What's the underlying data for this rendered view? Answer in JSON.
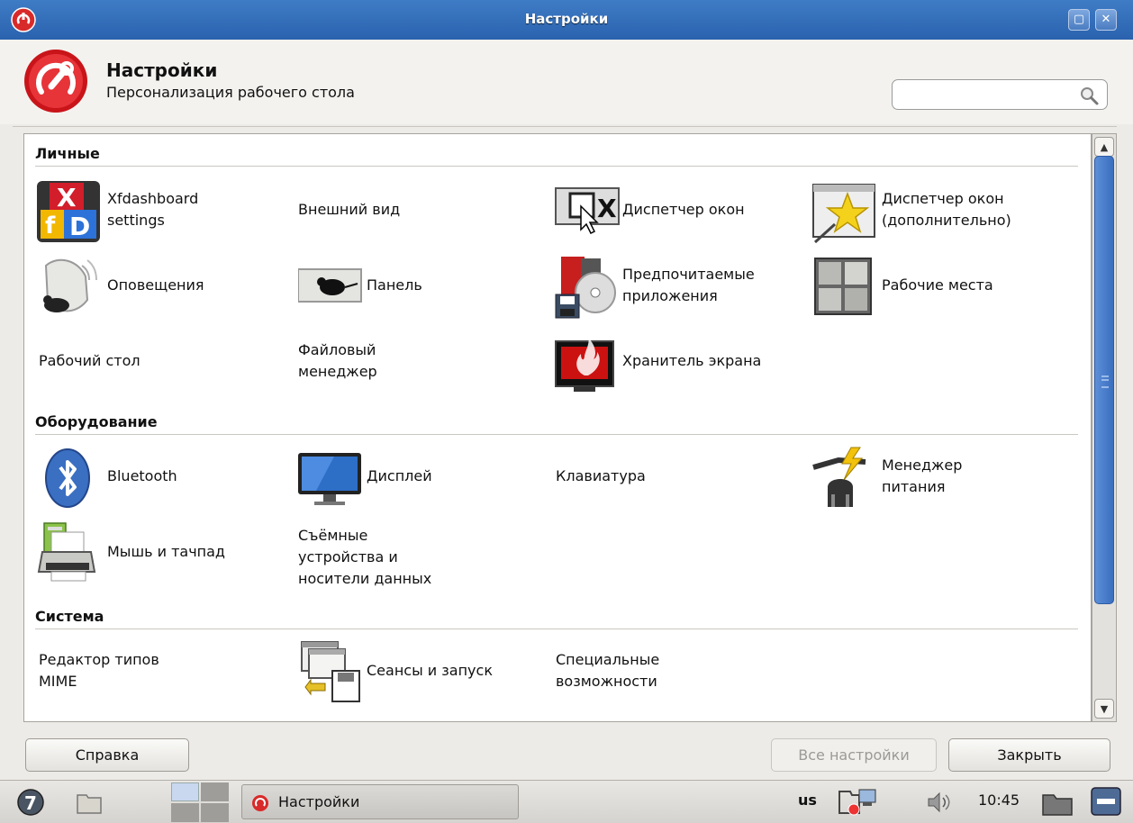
{
  "window": {
    "title": "Настройки"
  },
  "header": {
    "title": "Настройки",
    "subtitle": "Персонализация рабочего стола",
    "search_placeholder": ""
  },
  "sections": {
    "personal": {
      "title": "Личные",
      "items": [
        {
          "label": "Xfdashboard\nsettings",
          "icon": "xfdashboard-icon"
        },
        {
          "label": "Внешний вид",
          "icon": ""
        },
        {
          "label": "Диспетчер окон",
          "icon": "window-manager-icon"
        },
        {
          "label": "Диспетчер окон\n(дополнительно)",
          "icon": "window-manager-tweaks-icon"
        },
        {
          "label": "Оповещения",
          "icon": "notifications-icon"
        },
        {
          "label": "Панель",
          "icon": "panel-icon"
        },
        {
          "label": "Предпочитаемые\nприложения",
          "icon": "preferred-apps-icon"
        },
        {
          "label": "Рабочие места",
          "icon": "workspaces-icon"
        },
        {
          "label": "Рабочий стол",
          "icon": ""
        },
        {
          "label": "Файловый\nменеджер",
          "icon": ""
        },
        {
          "label": "Хранитель экрана",
          "icon": "screensaver-icon"
        }
      ]
    },
    "hardware": {
      "title": "Оборудование",
      "items": [
        {
          "label": "Bluetooth",
          "icon": "bluetooth-icon"
        },
        {
          "label": "Дисплей",
          "icon": "display-icon"
        },
        {
          "label": "Клавиатура",
          "icon": ""
        },
        {
          "label": "Менеджер\nпитания",
          "icon": "power-manager-icon"
        },
        {
          "label": "Мышь и тачпад",
          "icon": "mouse-printer-icon"
        },
        {
          "label": "Съёмные\nустройства и\nносители данных",
          "icon": ""
        }
      ]
    },
    "system": {
      "title": "Система",
      "items": [
        {
          "label": "Редактор типов\nMIME",
          "icon": ""
        },
        {
          "label": "Сеансы и запуск",
          "icon": "sessions-icon"
        },
        {
          "label": "Специальные\nвозможности",
          "icon": ""
        }
      ]
    }
  },
  "buttons": {
    "help": "Справка",
    "all_settings": "Все настройки",
    "close": "Закрыть"
  },
  "taskbar": {
    "task_label": "Настройки",
    "keyboard_layout": "us",
    "clock": "10:45"
  }
}
